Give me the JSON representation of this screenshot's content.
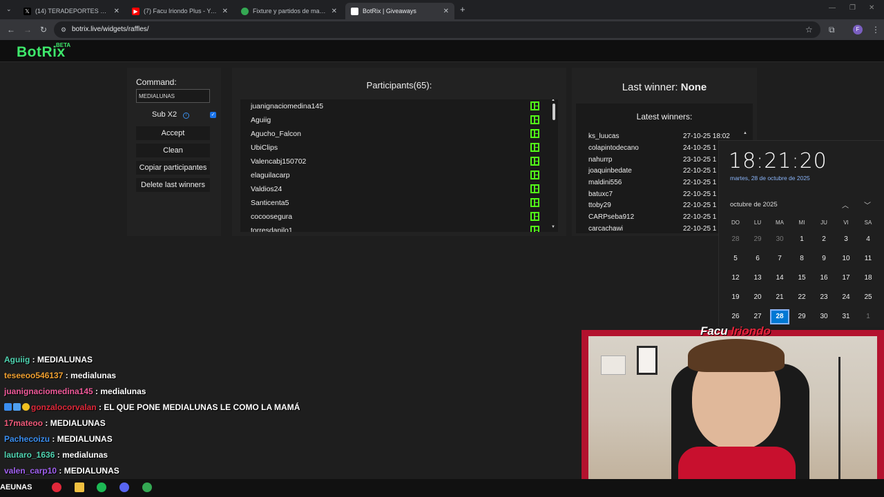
{
  "browser": {
    "tabs": [
      {
        "title": "(14) TERADEPORTES on X: \"sa",
        "favicon": "x-icon",
        "active": false
      },
      {
        "title": "(7) Facu Iriondo Plus - YouTube",
        "favicon": "youtube-icon",
        "active": false
      },
      {
        "title": "Fixture y partidos de mañana e",
        "favicon": "globe-icon",
        "active": false
      },
      {
        "title": "BotRix | Giveaways",
        "favicon": "botrix-icon",
        "active": true
      }
    ],
    "url": "botrix.live/widgets/raffles/",
    "profile_initial": "F"
  },
  "header": {
    "logo": "BotRix",
    "badge": "BETA"
  },
  "command_panel": {
    "label": "Command:",
    "value": "MEDIALUNAS",
    "sub_label": "Sub X2",
    "sub_checked": true,
    "buttons": [
      "Accept",
      "Clean",
      "Copiar participantes",
      "Delete last winners"
    ]
  },
  "participants": {
    "title": "Participants(65):",
    "items": [
      "juanignaciomedina145",
      "Aguiig",
      "Agucho_Falcon",
      "UbiClips",
      "Valencabj150702",
      "elaguilacarp",
      "Valdios24",
      "Santicenta5",
      "cocoosegura",
      "torresdanilo1"
    ]
  },
  "winners": {
    "last_label": "Last winner:",
    "last_value": "None",
    "latest_title": "Latest winners:",
    "items": [
      {
        "name": "ks_luucas",
        "date": "27-10-25 18:02"
      },
      {
        "name": "colapintodecano",
        "date": "24-10-25 1"
      },
      {
        "name": "nahurrp",
        "date": "23-10-25 1"
      },
      {
        "name": "joaquinbedate",
        "date": "22-10-25 1"
      },
      {
        "name": "maldini556",
        "date": "22-10-25 1"
      },
      {
        "name": "batuxc7",
        "date": "22-10-25 1"
      },
      {
        "name": "ttoby29",
        "date": "22-10-25 1"
      },
      {
        "name": "CARPseba912",
        "date": "22-10-25 1"
      },
      {
        "name": "carcachawi",
        "date": "22-10-25 1"
      }
    ]
  },
  "clock": {
    "time": "18:21:20",
    "date": "martes, 28 de octubre de 2025",
    "month": "octubre de 2025",
    "weekdays": [
      "DO",
      "LU",
      "MA",
      "MI",
      "JU",
      "VI",
      "SA"
    ],
    "weeks": [
      [
        "28",
        "29",
        "30",
        "1",
        "2",
        "3",
        "4"
      ],
      [
        "5",
        "6",
        "7",
        "8",
        "9",
        "10",
        "11"
      ],
      [
        "12",
        "13",
        "14",
        "15",
        "16",
        "17",
        "18"
      ],
      [
        "19",
        "20",
        "21",
        "22",
        "23",
        "24",
        "25"
      ],
      [
        "26",
        "27",
        "28",
        "29",
        "30",
        "31",
        "1"
      ]
    ],
    "today": "28"
  },
  "chat": [
    {
      "user": "Aguiig",
      "color": "#4fd3b0",
      "text": "MEDIALUNAS",
      "badges": false
    },
    {
      "user": "teseeoo546137",
      "color": "#f0a030",
      "text": "medialunas",
      "badges": false
    },
    {
      "user": "juanignaciomedina145",
      "color": "#f05a9a",
      "text": "medialunas",
      "badges": false
    },
    {
      "user": "gonzalocorvalan",
      "color": "#e0283a",
      "text": "EL QUE PONE MEDIALUNAS LE COMO LA MAMÁ",
      "badges": true
    },
    {
      "user": "17mateoo",
      "color": "#f05a7a",
      "text": "MEDIALUNAS",
      "badges": false
    },
    {
      "user": "Pachecoizu",
      "color": "#3a8ef0",
      "text": "MEDIALUNAS",
      "badges": false
    },
    {
      "user": "lautaro_1636",
      "color": "#4fd3b0",
      "text": "medialunas",
      "badges": false
    },
    {
      "user": "valen_carp10",
      "color": "#a060f0",
      "text": "MEDIALUNAS",
      "badges": false
    }
  ],
  "cam": {
    "name_first": "Facu",
    "name_last": "Iriondo"
  },
  "taskbar": {
    "label": "AEUNAS"
  }
}
